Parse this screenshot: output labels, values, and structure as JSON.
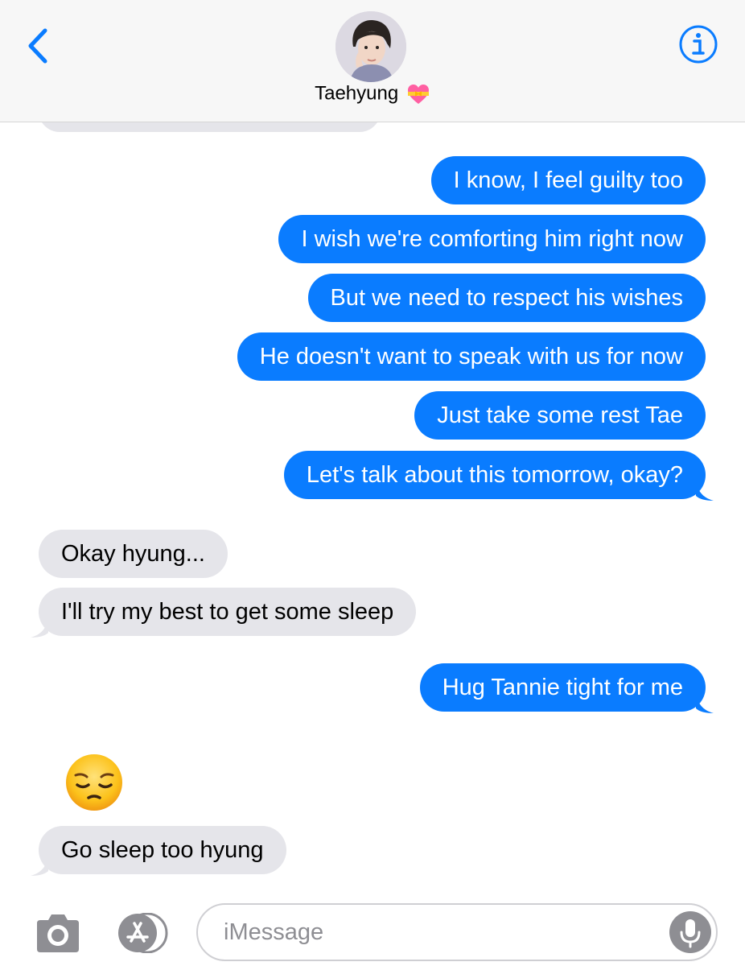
{
  "header": {
    "contact_name": "Taehyung",
    "name_emoji": "heart-with-ribbon-icon",
    "back_icon": "chevron-left-icon",
    "info_icon": "info-icon"
  },
  "messages": [
    {
      "side": "sent",
      "text": "I know, I feel guilty too"
    },
    {
      "side": "sent",
      "text": "I wish we're comforting him right now"
    },
    {
      "side": "sent",
      "text": "But we need to respect his wishes"
    },
    {
      "side": "sent",
      "text": "He doesn't want to speak with us for now"
    },
    {
      "side": "sent",
      "text": "Just take some rest Tae"
    },
    {
      "side": "sent",
      "text": "Let's talk about this tomorrow, okay?"
    },
    {
      "side": "received",
      "text": "Okay hyung..."
    },
    {
      "side": "received",
      "text": "I'll try my best to get some sleep"
    },
    {
      "side": "sent",
      "text": "Hug Tannie tight for me"
    },
    {
      "side": "received",
      "emoji": "pensive-face-icon"
    },
    {
      "side": "received",
      "text": "Go sleep too hyung"
    }
  ],
  "input_bar": {
    "placeholder": "iMessage",
    "camera_icon": "camera-icon",
    "apps_icon": "app-store-icon",
    "mic_icon": "microphone-icon"
  },
  "colors": {
    "sent_bubble": "#0a7cff",
    "received_bubble": "#e5e5ea",
    "accent": "#0a7cff"
  }
}
